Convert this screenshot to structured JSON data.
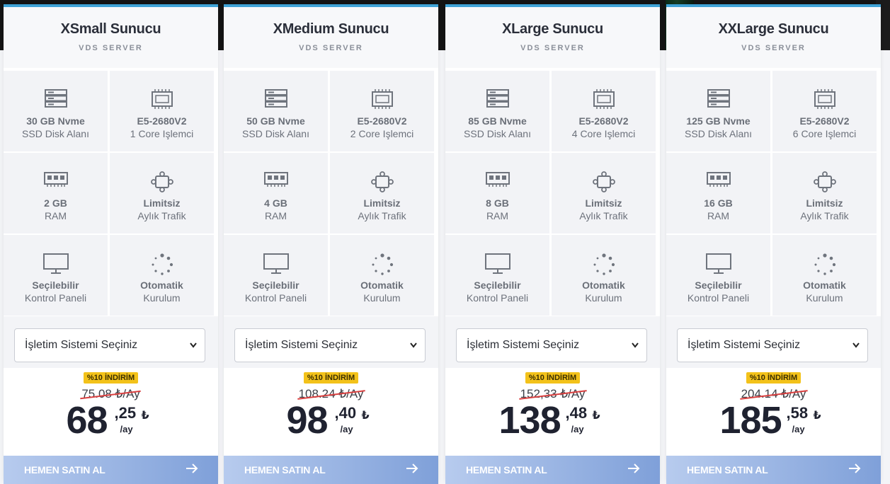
{
  "colors": {
    "accent_top": "#3fa2d6",
    "badge": "#f3c21a",
    "button_start": "#b7cbee",
    "button_end": "#7fa0d9",
    "strike": "#d94040"
  },
  "plans": [
    {
      "title": "XSmall Sunucu",
      "subtitle": "VDS SERVER",
      "disk_l1": "30 GB Nvme",
      "disk_l2": "SSD Disk Alanı",
      "cpu_l1": "E5-2680V2",
      "cpu_l2": "1 Core Işlemci",
      "ram_l1": "2 GB",
      "ram_l2": "RAM",
      "traffic_l1": "Limitsiz",
      "traffic_l2": "Aylık Trafik",
      "panel_l1": "Seçilebilir",
      "panel_l2": "Kontrol Paneli",
      "setup_l1": "Otomatik",
      "setup_l2": "Kurulum",
      "os_value": "İşletim Sistemi Seçiniz",
      "discount": "%10 İNDİRİM",
      "old_price": "75.08 ₺/Ay",
      "price_int": "68",
      "price_frac": ",25",
      "currency": "₺",
      "per": "/ay",
      "buy_label": "HEMEN SATIN AL"
    },
    {
      "title": "XMedium Sunucu",
      "subtitle": "VDS SERVER",
      "disk_l1": "50 GB Nvme",
      "disk_l2": "SSD Disk Alanı",
      "cpu_l1": "E5-2680V2",
      "cpu_l2": "2 Core Işlemci",
      "ram_l1": "4 GB",
      "ram_l2": "RAM",
      "traffic_l1": "Limitsiz",
      "traffic_l2": "Aylık Trafik",
      "panel_l1": "Seçilebilir",
      "panel_l2": "Kontrol Paneli",
      "setup_l1": "Otomatik",
      "setup_l2": "Kurulum",
      "os_value": "İşletim Sistemi Seçiniz",
      "discount": "%10 İNDİRİM",
      "old_price": "108.24 ₺/Ay",
      "price_int": "98",
      "price_frac": ",40",
      "currency": "₺",
      "per": "/ay",
      "buy_label": "HEMEN SATIN AL"
    },
    {
      "title": "XLarge Sunucu",
      "subtitle": "VDS SERVER",
      "disk_l1": "85 GB Nvme",
      "disk_l2": "SSD Disk Alanı",
      "cpu_l1": "E5-2680V2",
      "cpu_l2": "4 Core Işlemci",
      "ram_l1": "8 GB",
      "ram_l2": "RAM",
      "traffic_l1": "Limitsiz",
      "traffic_l2": "Aylık Trafik",
      "panel_l1": "Seçilebilir",
      "panel_l2": "Kontrol Paneli",
      "setup_l1": "Otomatik",
      "setup_l2": "Kurulum",
      "os_value": "İşletim Sistemi Seçiniz",
      "discount": "%10 İNDİRİM",
      "old_price": "152,33 ₺/Ay",
      "price_int": "138",
      "price_frac": ",48",
      "currency": "₺",
      "per": "/ay",
      "buy_label": "HEMEN SATIN AL"
    },
    {
      "title": "XXLarge Sunucu",
      "subtitle": "VDS SERVER",
      "disk_l1": "125 GB Nvme",
      "disk_l2": "SSD Disk Alanı",
      "cpu_l1": "E5-2680V2",
      "cpu_l2": "6 Core Işlemci",
      "ram_l1": "16 GB",
      "ram_l2": "RAM",
      "traffic_l1": "Limitsiz",
      "traffic_l2": "Aylık Trafik",
      "panel_l1": "Seçilebilir",
      "panel_l2": "Kontrol Paneli",
      "setup_l1": "Otomatik",
      "setup_l2": "Kurulum",
      "os_value": "İşletim Sistemi Seçiniz",
      "discount": "%10 İNDİRİM",
      "old_price": "204.14 ₺/Ay",
      "price_int": "185",
      "price_frac": ",58",
      "currency": "₺",
      "per": "/ay",
      "buy_label": "HEMEN SATIN AL"
    }
  ]
}
